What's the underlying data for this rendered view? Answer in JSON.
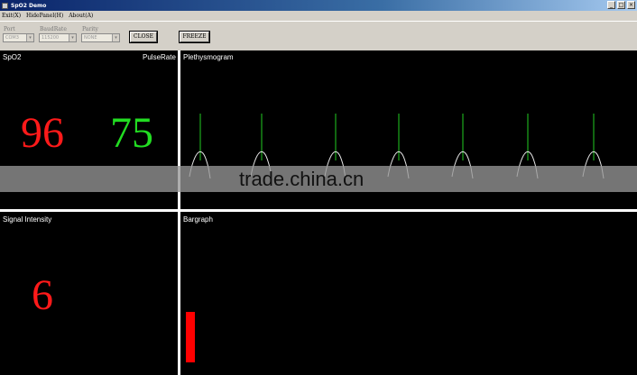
{
  "window": {
    "title": "SpO2 Demo",
    "controls": [
      "_",
      "□",
      "×"
    ]
  },
  "menu": {
    "items": [
      "Exit(X)",
      "HidePanel(H)",
      "About(A)"
    ]
  },
  "toolbar": {
    "port_label": "Port",
    "port_value": "COM3",
    "baudrate_label": "BaudRate",
    "baudrate_value": "115200",
    "parity_label": "Parity",
    "parity_value": "NONE",
    "close_button": "CLOSE",
    "freeze_button": "FREEZE"
  },
  "panels": {
    "spo2": {
      "title": "SpO2",
      "value": "96",
      "color": "#ff1a1a"
    },
    "pulse": {
      "title": "PulseRate",
      "value": "75",
      "color": "#22dd22"
    },
    "pleth": {
      "title": "Plethysmogram",
      "peaks": [
        222,
        290,
        372,
        442,
        513,
        585,
        658
      ]
    },
    "signal": {
      "title": "Signal Intensity",
      "value": "6",
      "color": "#ff1a1a"
    },
    "bargraph": {
      "title": "Bargraph",
      "level": 0.35,
      "color": "#ff0000"
    }
  },
  "watermark": "trade.china.cn"
}
